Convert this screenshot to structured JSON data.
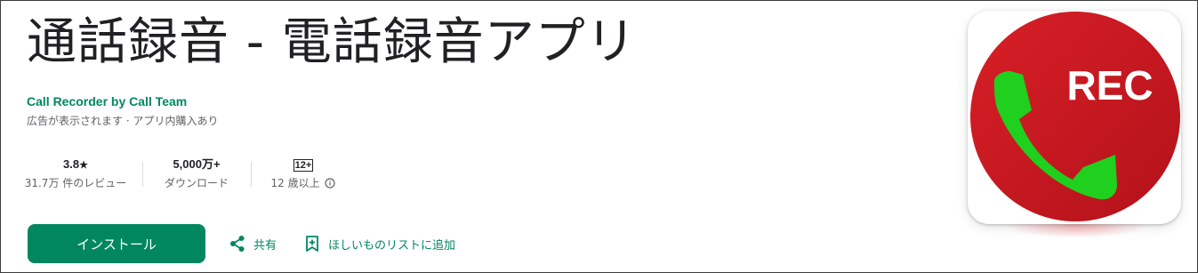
{
  "app": {
    "title": "通話録音 - 電話録音アプリ",
    "developer": "Call Recorder by Call Team",
    "notes": "広告が表示されます · アプリ内購入あり"
  },
  "stats": {
    "rating_value": "3.8",
    "rating_star": "★",
    "reviews_label": "31.7万 件のレビュー",
    "downloads_value": "5,000万+",
    "downloads_label": "ダウンロード",
    "age_badge": "12+",
    "age_label": "12 歳以上"
  },
  "actions": {
    "install_label": "インストール",
    "share_label": "共有",
    "wishlist_label": "ほしいものリストに追加"
  },
  "app_icon": {
    "text": "REC",
    "red_color": "#e01b24",
    "phone_color": "#1fd01f"
  },
  "colors": {
    "accent": "#01875f"
  }
}
